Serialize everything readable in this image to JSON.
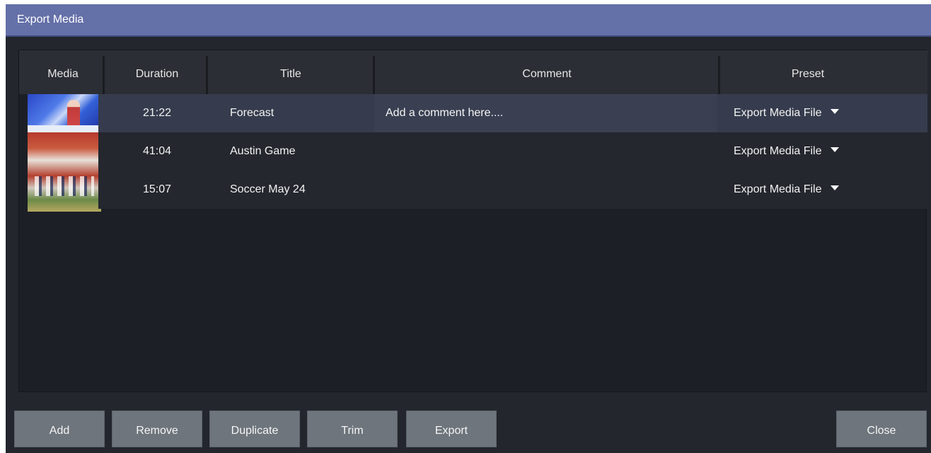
{
  "window": {
    "title": "Export Media"
  },
  "table": {
    "columns": {
      "media": "Media",
      "duration": "Duration",
      "title": "Title",
      "comment": "Comment",
      "preset": "Preset"
    },
    "rows": [
      {
        "duration": "21:22",
        "title": "Forecast",
        "comment": "Add a comment here....",
        "preset": "Export Media File"
      },
      {
        "duration": "41:04",
        "title": "Austin Game",
        "comment": "",
        "preset": "Export Media File"
      },
      {
        "duration": "15:07",
        "title": "Soccer May 24",
        "comment": "",
        "preset": "Export Media File"
      }
    ]
  },
  "buttons": {
    "add": "Add",
    "remove": "Remove",
    "duplicate": "Duplicate",
    "trim": "Trim",
    "export": "Export",
    "close": "Close"
  },
  "colors": {
    "titlebar": "#6470a8",
    "window_bg": "#23262d",
    "selected_row": "#363c4d",
    "button": "#6e757c"
  },
  "icons": {
    "dropdown": "caret-down-icon"
  }
}
